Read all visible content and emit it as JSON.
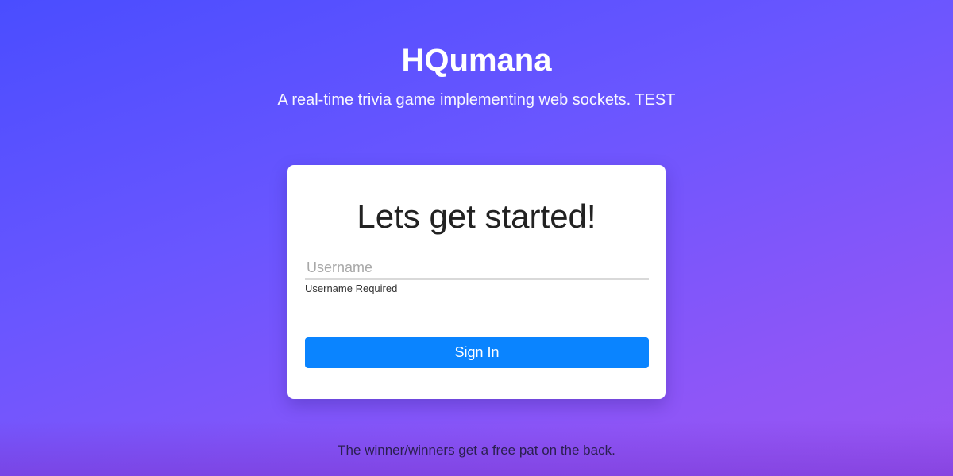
{
  "header": {
    "title": "HQumana",
    "subtitle": "A real-time trivia game implementing web sockets. TEST"
  },
  "login_card": {
    "heading": "Lets get started!",
    "username_placeholder": "Username",
    "username_value": "",
    "username_hint": "Username Required",
    "sign_in_label": "Sign In"
  },
  "footer": {
    "text": "The winner/winners get a free pat on the back."
  },
  "colors": {
    "background_start": "#4a4dff",
    "background_end": "#9a55f2",
    "button": "#0a84ff",
    "card": "#ffffff"
  }
}
